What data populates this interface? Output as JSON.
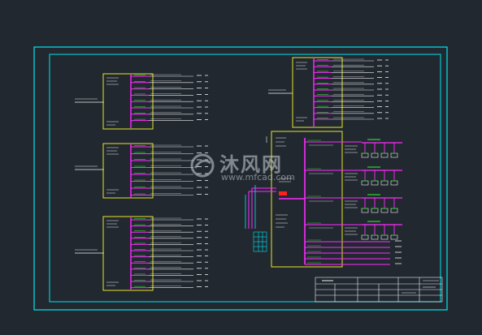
{
  "drawing": {
    "frame_color": "#00e5f0",
    "panel_color": "#e6e62a",
    "bus_color": "#ff2bff",
    "branch_color": "#f2f2f2",
    "breaker_color": "#2bd92b",
    "alarm_color": "#ff2020",
    "background": "#212830"
  },
  "watermark": {
    "main": "沐风网",
    "sub": "www.mfcad.com",
    "icon": "mfcad-logo-icon"
  }
}
